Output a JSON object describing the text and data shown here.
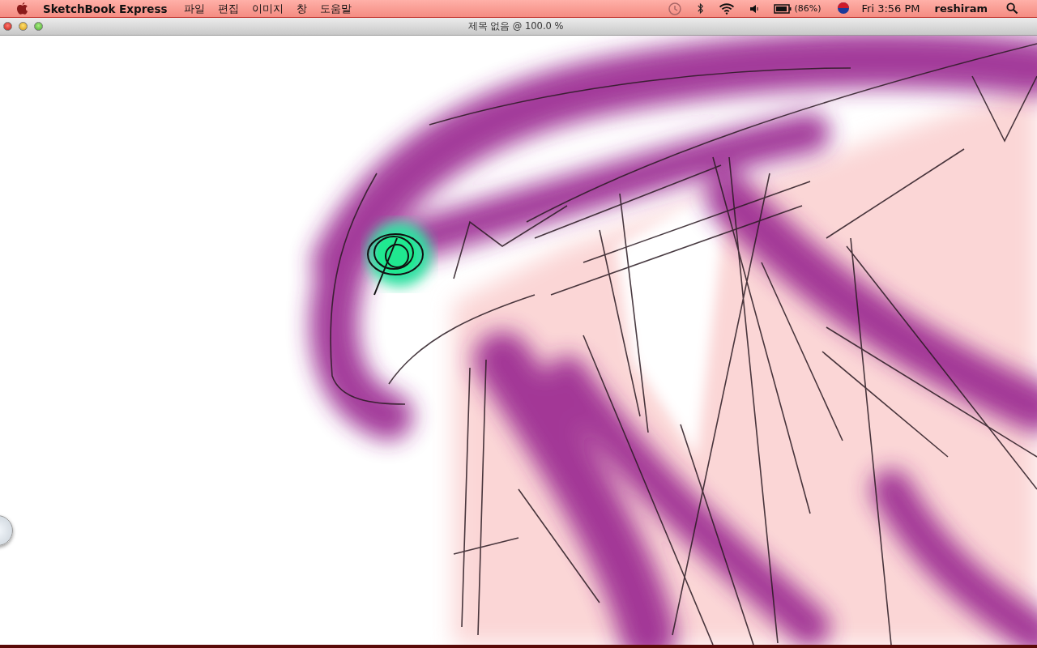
{
  "menu_bar": {
    "app_name": "SketchBook Express",
    "menus": [
      "파일",
      "편집",
      "이미지",
      "창",
      "도움말"
    ],
    "battery": "(86%)",
    "clock": "Fri 3:56 PM",
    "user": "reshiram"
  },
  "window": {
    "title": "제목 없음 @ 100.0 %"
  }
}
